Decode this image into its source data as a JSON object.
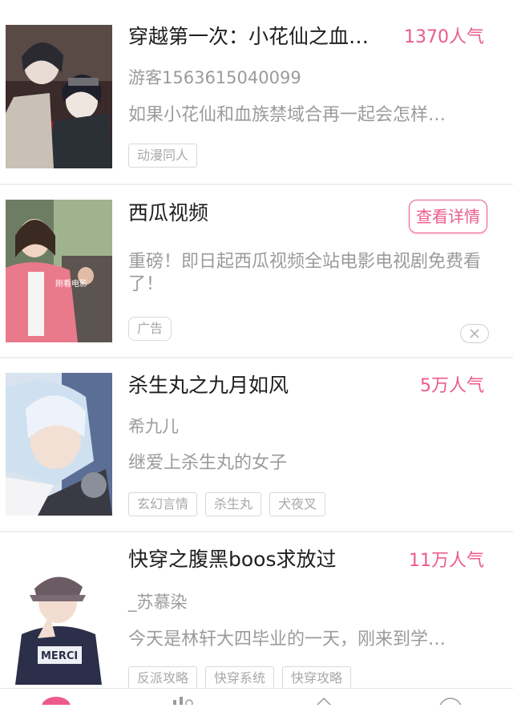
{
  "items": [
    {
      "title": "穿越第一次：小花仙之血…",
      "popularity": "1370人气",
      "author": "游客1563615040099",
      "description": "如果小花仙和血族禁域合再一起会怎样…",
      "tags": [
        "动漫同人"
      ]
    },
    {
      "title": "西瓜视频",
      "detail_button": "查看详情",
      "description": "重磅！即日起西瓜视频全站电影电视剧免费看了！",
      "ad_label": "广告",
      "cover_caption": "刚看电影"
    },
    {
      "title": "杀生丸之九月如风",
      "popularity": "5万人气",
      "author": "希九儿",
      "description": "继爱上杀生丸的女子",
      "tags": [
        "玄幻言情",
        "杀生丸",
        "犬夜叉"
      ]
    },
    {
      "title": "快穿之腹黑boos求放过",
      "popularity": "11万人气",
      "author": "_苏慕染",
      "description": "今天是林轩大四毕业的一天，刚来到学…",
      "tags": [
        "反派攻略",
        "快穿系统",
        "快穿攻略"
      ],
      "cover_caption": "MERCI"
    }
  ],
  "colors": {
    "accent": "#ec5b8c",
    "muted": "#9b9b9b",
    "tag_border": "#d9d9d9"
  }
}
